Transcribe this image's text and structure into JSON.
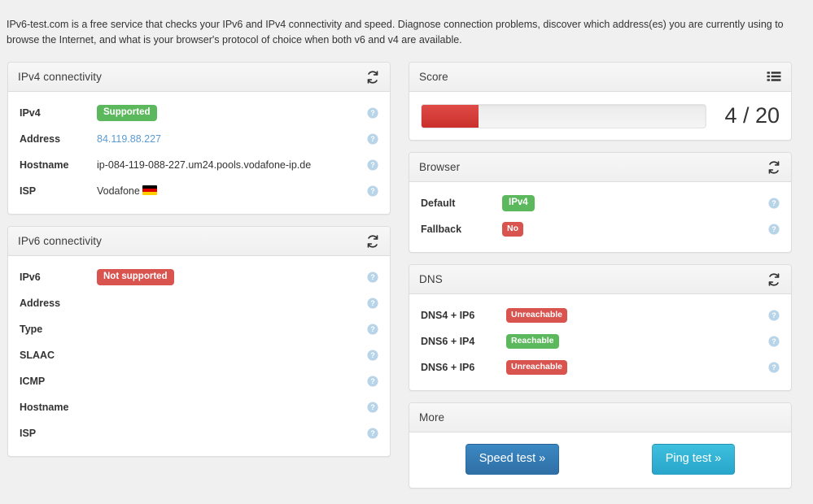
{
  "intro": {
    "text": "IPv6-test.com is a free service that checks your IPv6 and IPv4 connectivity and speed. Diagnose connection problems, discover which address(es) you are currently using to browse the Internet, and what is your browser's protocol of choice when both v6 and v4 are available."
  },
  "icons": {
    "refresh": "refresh-icon",
    "list": "th-list-icon",
    "help": "help-circle-icon"
  },
  "panels": {
    "ipv4": {
      "title": "IPv4 connectivity",
      "refresh_icon": "refresh-icon",
      "rows": [
        {
          "label": "IPv4",
          "value": "Supported",
          "kind": "badge-green"
        },
        {
          "label": "Address",
          "value": "84.119.88.227",
          "kind": "link"
        },
        {
          "label": "Hostname",
          "value": "ip-084-119-088-227.um24.pools.vodafone-ip.de",
          "kind": "text"
        },
        {
          "label": "ISP",
          "value": "Vodafone",
          "kind": "text-flag",
          "flag": "DE"
        }
      ]
    },
    "ipv6": {
      "title": "IPv6 connectivity",
      "refresh_icon": "refresh-icon",
      "rows": [
        {
          "label": "IPv6",
          "value": "Not supported",
          "kind": "badge-red"
        },
        {
          "label": "Address",
          "value": "",
          "kind": "text"
        },
        {
          "label": "Type",
          "value": "",
          "kind": "text"
        },
        {
          "label": "SLAAC",
          "value": "",
          "kind": "text"
        },
        {
          "label": "ICMP",
          "value": "",
          "kind": "text"
        },
        {
          "label": "Hostname",
          "value": "",
          "kind": "text"
        },
        {
          "label": "ISP",
          "value": "",
          "kind": "text"
        }
      ]
    },
    "score": {
      "title": "Score",
      "list_icon": "th-list-icon",
      "value": 4,
      "max": 20,
      "display": "4 / 20",
      "percent": 20,
      "bar_color": "#d9534f"
    },
    "browser": {
      "title": "Browser",
      "refresh_icon": "refresh-icon",
      "rows": [
        {
          "label": "Default",
          "value": "IPv4",
          "kind": "badge-green"
        },
        {
          "label": "Fallback",
          "value": "No",
          "kind": "badge-red"
        }
      ]
    },
    "dns": {
      "title": "DNS",
      "refresh_icon": "refresh-icon",
      "rows": [
        {
          "label": "DNS4 + IP6",
          "value": "Unreachable",
          "kind": "badge-red"
        },
        {
          "label": "DNS6 + IP4",
          "value": "Reachable",
          "kind": "badge-green"
        },
        {
          "label": "DNS6 + IP6",
          "value": "Unreachable",
          "kind": "badge-red"
        }
      ]
    },
    "more": {
      "title": "More",
      "buttons": [
        {
          "label": "Speed test »",
          "style": "primary"
        },
        {
          "label": "Ping test »",
          "style": "info"
        }
      ]
    }
  },
  "colors": {
    "success": "#5cb85c",
    "danger": "#d9534f",
    "link": "#5b9bd1",
    "primary": "#337ab7",
    "info": "#31b0d5",
    "page_bg": "#f0f0f0",
    "panel_border": "#dddddd"
  }
}
